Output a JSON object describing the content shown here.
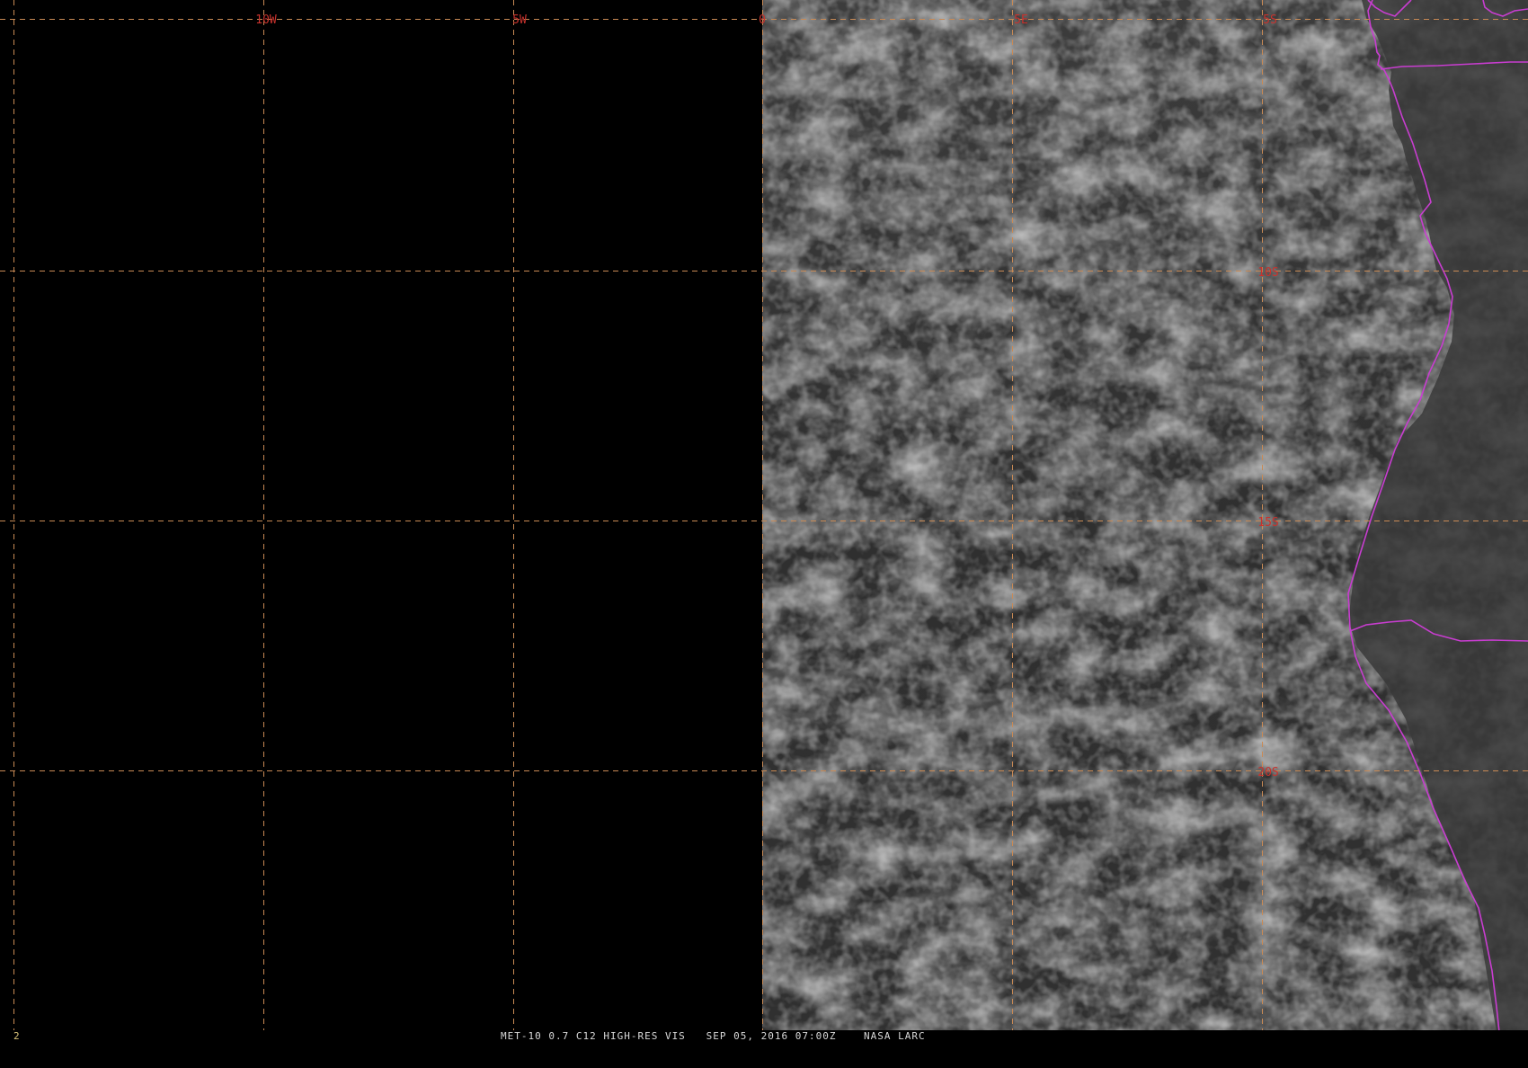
{
  "map": {
    "longitude_labels": [
      "10W",
      "5W",
      "0",
      "5E",
      "5S"
    ],
    "latitude_labels": [
      "10S",
      "15S",
      "20S"
    ],
    "colors": {
      "grid": "#c98a55",
      "grid_label": "#c8322d",
      "border": "#c83dd0",
      "background": "#000000",
      "imagery_base": "#494949"
    }
  },
  "status_bar": {
    "frame_number": "2",
    "caption": "MET-10 0.7 C12 HIGH-RES VIS   SEP 05, 2016 07:00Z    NASA LARC"
  }
}
